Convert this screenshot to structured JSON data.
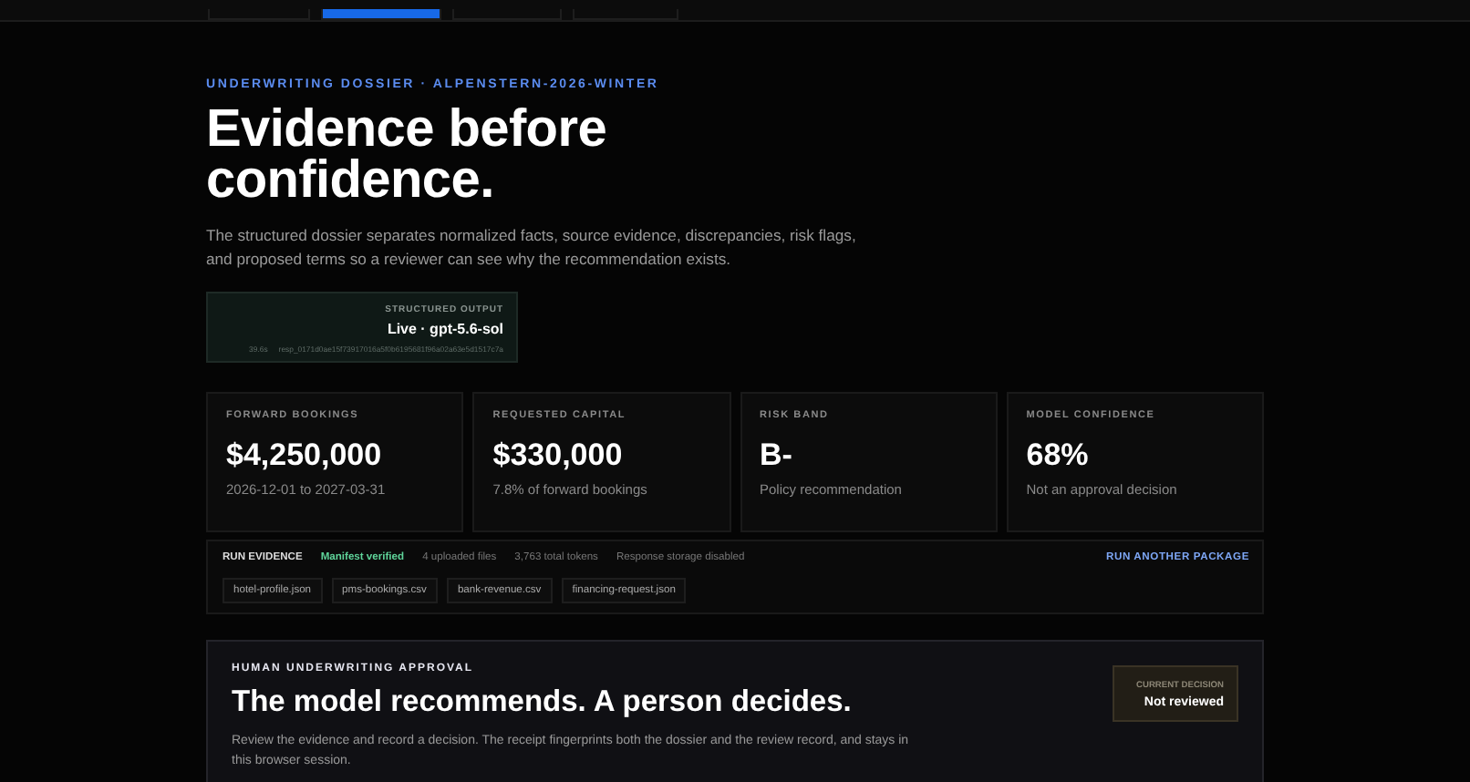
{
  "tabs": [
    {
      "selected": false
    },
    {
      "selected": true
    },
    {
      "selected": false
    },
    {
      "selected": false
    }
  ],
  "eyebrow": "UNDERWRITING DOSSIER · ALPENSTERN-2026-WINTER",
  "title_lines": [
    "Evidence before",
    "confidence."
  ],
  "intro": "The structured dossier separates normalized facts, source evidence, discrepancies, risk flags, and proposed terms so a reviewer can see why the recommendation exists.",
  "output": {
    "label": "STRUCTURED OUTPUT",
    "model": "Live · gpt-5.6-sol",
    "duration": "39.6s",
    "response_id": "resp_0171d0ae15f73917016a5f0b6195681f96a02a63e5d1517c7a"
  },
  "metrics": [
    {
      "label": "FORWARD BOOKINGS",
      "value": "$4,250,000",
      "note": "2026-12-01 to 2027-03-31"
    },
    {
      "label": "REQUESTED CAPITAL",
      "value": "$330,000",
      "note": "7.8% of forward bookings"
    },
    {
      "label": "RISK BAND",
      "value": "B-",
      "note": "Policy recommendation"
    },
    {
      "label": "MODEL CONFIDENCE",
      "value": "68%",
      "note": "Not an approval decision"
    }
  ],
  "run_evidence": {
    "title": "RUN EVIDENCE",
    "status": "Manifest verified",
    "facts": [
      "4 uploaded files",
      "3,763 total tokens",
      "Response storage disabled"
    ],
    "action": "RUN ANOTHER PACKAGE",
    "files": [
      "hotel-profile.json",
      "pms-bookings.csv",
      "bank-revenue.csv",
      "financing-request.json"
    ]
  },
  "approval": {
    "eyebrow": "HUMAN UNDERWRITING APPROVAL",
    "heading": "The model recommends. A person decides.",
    "body": "Review the evidence and record a decision. The receipt fingerprints both the dossier and the review record, and stays in this browser session.",
    "decision_label": "CURRENT DECISION",
    "decision": "Not reviewed"
  }
}
